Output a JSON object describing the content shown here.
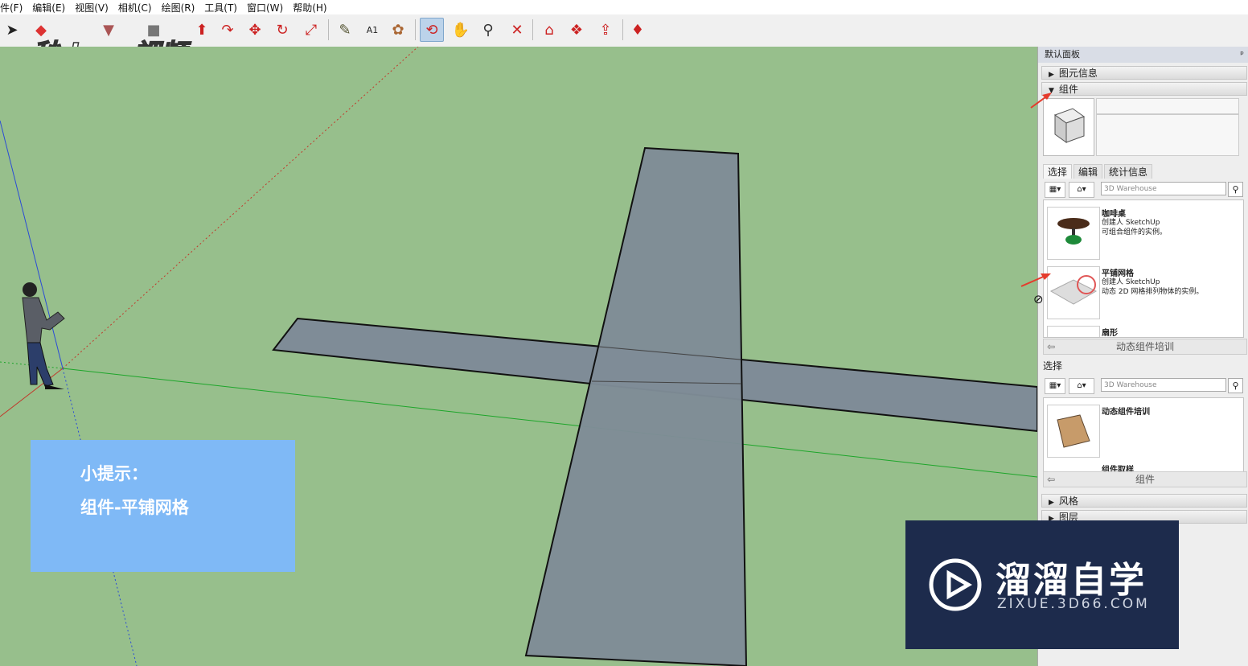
{
  "menubar": {
    "items": [
      "件(F)",
      "编辑(E)",
      "视图(V)",
      "相机(C)",
      "绘图(R)",
      "工具(T)",
      "窗口(W)",
      "帮助(H)"
    ]
  },
  "toolbar": {
    "logo_text": "秒dong视频",
    "tools": [
      "select-icon",
      "eraser-icon",
      "paint-icon",
      "rectangle-icon",
      "push-pull-icon",
      "follow-me-icon",
      "move-icon",
      "rotate-icon",
      "scale-icon",
      "tape-measure-icon",
      "text-icon",
      "paint-bucket-icon",
      "orbit-icon",
      "pan-icon",
      "zoom-icon",
      "zoom-extents-icon",
      "warehouse-icon",
      "component-icon",
      "share-icon",
      "ruby-icon"
    ]
  },
  "tip": {
    "line1": "小提示：",
    "line2": "组件-平铺网格"
  },
  "panel": {
    "title": "默认面板",
    "pin": "ᵖ",
    "section_entity_info": "图元信息",
    "section_components": "组件",
    "tabs": [
      "选择",
      "编辑",
      "统计信息"
    ],
    "search_placeholder": "3D Warehouse",
    "items": [
      {
        "name": "咖啡桌",
        "author": "创建人 SketchUp",
        "desc": "可组合组件的实例。"
      },
      {
        "name": "平铺网格",
        "author": "创建人 SketchUp",
        "desc": "动态 2D 网格排列物体的实例。"
      },
      {
        "name": "扇形",
        "author": "",
        "desc": ""
      }
    ],
    "nav1_label": "动态组件培训",
    "select2_label": "选择",
    "search2_placeholder": "3D Warehouse",
    "items2": [
      {
        "name": "动态组件培训"
      },
      {
        "name": "组件取样"
      }
    ],
    "nav2_label": "组件",
    "section_styles": "风格",
    "section_layers": "图层"
  },
  "watermark": {
    "title": "溜溜自学",
    "url": "ZIXUE.3D66.COM"
  },
  "colors": {
    "ground": "#97bf8c",
    "shape_fill": "#7f8c97",
    "tip_bg": "#7fb9f6",
    "watermark_bg": "#1d2b4c",
    "arrow_red": "#e53b2c"
  }
}
